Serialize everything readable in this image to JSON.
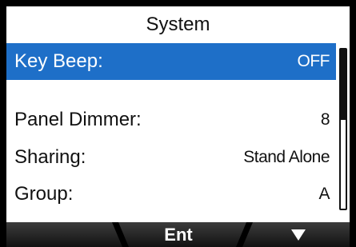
{
  "screen": {
    "title": "System"
  },
  "menu": {
    "items": [
      {
        "label": "Key Beep:",
        "value": "OFF",
        "selected": true
      },
      {
        "label": "Panel Dimmer:",
        "value": "8",
        "selected": false
      },
      {
        "label": "Sharing:",
        "value": "Stand Alone",
        "selected": false
      },
      {
        "label": "Group:",
        "value": "A",
        "selected": false
      }
    ]
  },
  "softkeys": {
    "left": "",
    "middle": "Ent",
    "right_icon": "down-arrow-icon"
  },
  "colors": {
    "selection": "#1e6fc8",
    "softkey_bar": "#1e1e1e",
    "bezel": "#000000"
  }
}
